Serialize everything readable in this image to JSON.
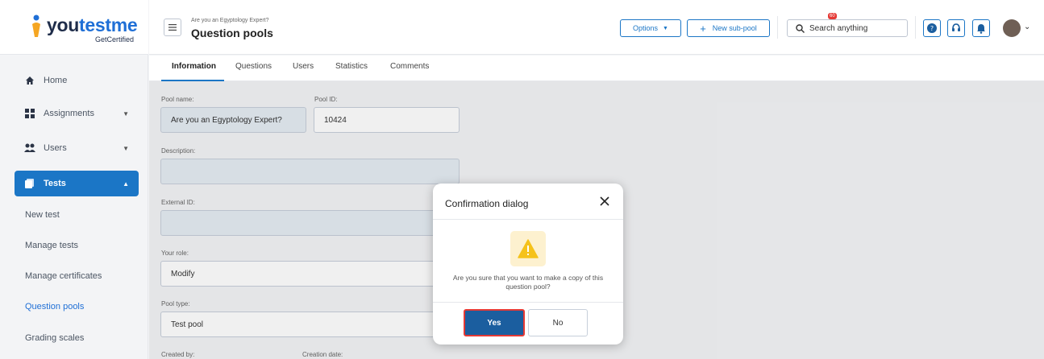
{
  "brand": {
    "name_part1": "you",
    "name_part2": "testme",
    "tagline": "GetCertified"
  },
  "sidebar": {
    "items": [
      {
        "label": "Home",
        "icon": "home-icon"
      },
      {
        "label": "Assignments",
        "icon": "grid-icon"
      },
      {
        "label": "Users",
        "icon": "users-icon"
      },
      {
        "label": "Tests",
        "icon": "tests-icon"
      }
    ],
    "sub_items": [
      "New test",
      "Manage tests",
      "Manage certificates",
      "Question pools",
      "Grading scales"
    ]
  },
  "header": {
    "breadcrumb": "Are you an Egyptology Expert?",
    "title": "Question pools",
    "options_label": "Options",
    "new_subpool_label": "New sub-pool",
    "search_placeholder": "Search anything",
    "notification_count": "60"
  },
  "tabs": [
    "Information",
    "Questions",
    "Users",
    "Statistics",
    "Comments"
  ],
  "form": {
    "pool_name_label": "Pool name:",
    "pool_name_value": "Are you an Egyptology Expert?",
    "pool_id_label": "Pool ID:",
    "pool_id_value": "10424",
    "description_label": "Description:",
    "external_id_label": "External ID:",
    "your_role_label": "Your role:",
    "your_role_value": "Modify",
    "pool_type_label": "Pool type:",
    "pool_type_value": "Test pool",
    "created_by_label": "Created by:",
    "creation_date_label": "Creation date:"
  },
  "dialog": {
    "title": "Confirmation dialog",
    "message": "Are you sure that you want to make a copy of this question pool?",
    "yes_label": "Yes",
    "no_label": "No"
  },
  "colors": {
    "primary": "#1b76c6",
    "yes_button": "#1b5e9f",
    "highlight": "#e53935",
    "warning": "#f5c21b"
  }
}
